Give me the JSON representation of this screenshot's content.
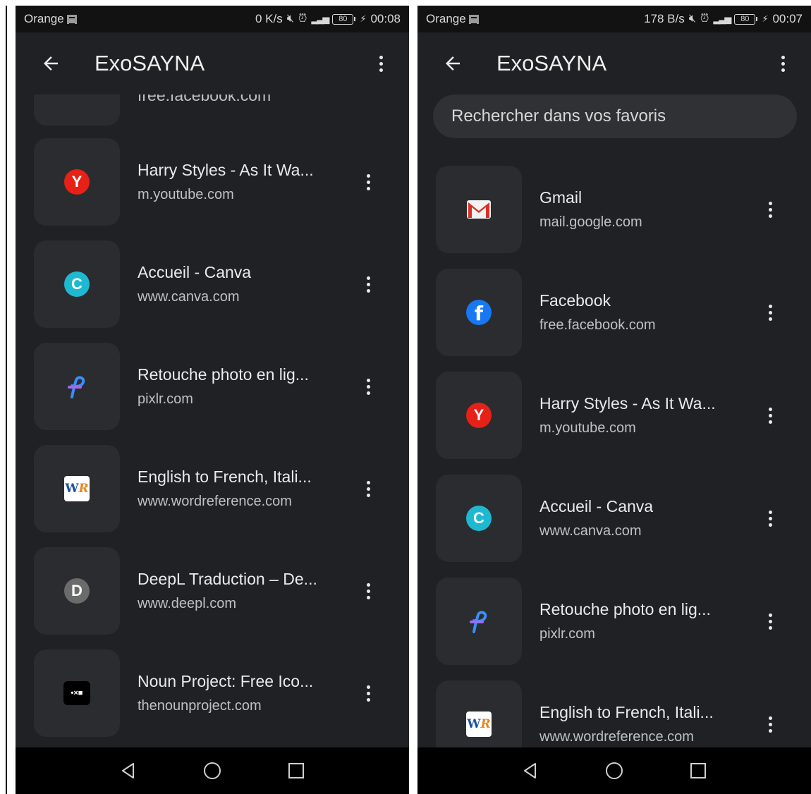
{
  "left": {
    "status": {
      "carrier": "Orange",
      "speed": "0 K/s",
      "battery": "80",
      "time": "00:08"
    },
    "app_title": "ExoSAYNA",
    "partial_url": "free.facebook.com",
    "items": [
      {
        "title": "Harry Styles - As It Wa...",
        "url": "m.youtube.com",
        "icon": "youtube-y-icon",
        "letter": "Y",
        "color": "#e62117"
      },
      {
        "title": "Accueil - Canva",
        "url": "www.canva.com",
        "icon": "canva-c-icon",
        "letter": "C",
        "color": "#1fb8d1"
      },
      {
        "title": "Retouche photo en lig...",
        "url": "pixlr.com",
        "icon": "pixlr-icon",
        "letter": "",
        "color": "#3a8ef6"
      },
      {
        "title": "English to French, Itali...",
        "url": "www.wordreference.com",
        "icon": "wordreference-icon",
        "letter": "WR",
        "color": "#ffffff"
      },
      {
        "title": "DeepL Traduction – De...",
        "url": "www.deepl.com",
        "icon": "deepl-d-icon",
        "letter": "D",
        "color": "#6b6b6b"
      },
      {
        "title": "Noun Project: Free Ico...",
        "url": "thenounproject.com",
        "icon": "noun-project-icon",
        "letter": "•×■",
        "color": "#000000"
      }
    ]
  },
  "right": {
    "status": {
      "carrier": "Orange",
      "speed": "178 B/s",
      "battery": "80",
      "time": "00:07"
    },
    "app_title": "ExoSAYNA",
    "search_placeholder": "Rechercher dans vos favoris",
    "items": [
      {
        "title": "Gmail",
        "url": "mail.google.com",
        "icon": "gmail-icon",
        "letter": "",
        "color": "#d93025"
      },
      {
        "title": "Facebook",
        "url": "free.facebook.com",
        "icon": "facebook-icon",
        "letter": "f",
        "color": "#1877f2"
      },
      {
        "title": "Harry Styles - As It Wa...",
        "url": "m.youtube.com",
        "icon": "youtube-y-icon",
        "letter": "Y",
        "color": "#e62117"
      },
      {
        "title": "Accueil - Canva",
        "url": "www.canva.com",
        "icon": "canva-c-icon",
        "letter": "C",
        "color": "#1fb8d1"
      },
      {
        "title": "Retouche photo en lig...",
        "url": "pixlr.com",
        "icon": "pixlr-icon",
        "letter": "",
        "color": "#3a8ef6"
      },
      {
        "title": "English to French, Itali...",
        "url": "www.wordreference.com",
        "icon": "wordreference-icon",
        "letter": "WR",
        "color": "#ffffff"
      }
    ]
  }
}
